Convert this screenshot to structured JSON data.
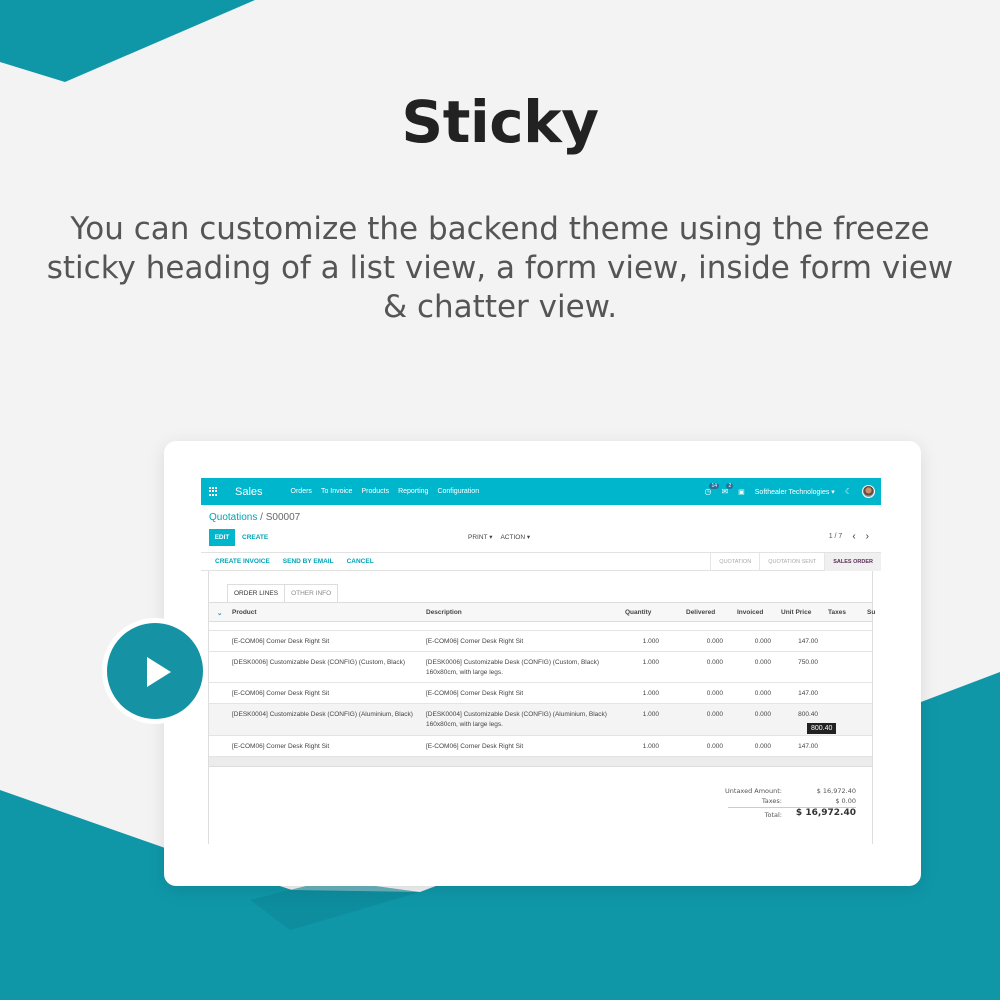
{
  "headline": "Sticky",
  "description": "You can customize the backend theme using the freeze sticky heading of a list view, a form view, inside form view & chatter view.",
  "colors": {
    "teal": "#0f97a8",
    "navbar": "#00b6cc",
    "accent_text": "#00a3b8"
  },
  "navbar": {
    "app_name": "Sales",
    "menu": [
      "Orders",
      "To Invoice",
      "Products",
      "Reporting",
      "Configuration"
    ],
    "activity_count": "14",
    "message_count": "2",
    "company": "Softhealer Technologies",
    "icons": [
      "apps-grid-icon",
      "clock-icon",
      "chat-icon",
      "gift-icon",
      "moon-icon",
      "avatar"
    ]
  },
  "breadcrumb": {
    "parent": "Quotations",
    "separator": "/",
    "current": "S00007"
  },
  "buttons": {
    "edit": "EDIT",
    "create": "CREATE",
    "print": "PRINT",
    "action": "ACTION"
  },
  "pager": {
    "text": "1 / 7"
  },
  "status_actions": [
    "CREATE INVOICE",
    "SEND BY EMAIL",
    "CANCEL"
  ],
  "stages": [
    {
      "label": "QUOTATION",
      "active": false
    },
    {
      "label": "QUOTATION SENT",
      "active": false
    },
    {
      "label": "SALES ORDER",
      "active": true
    }
  ],
  "tabs": [
    "ORDER LINES",
    "OTHER INFO"
  ],
  "table": {
    "headers": [
      "Product",
      "Description",
      "Quantity",
      "Delivered",
      "Invoiced",
      "Unit Price",
      "Taxes",
      "Su"
    ],
    "rows": [
      {
        "product": "[E-COM06] Corner Desk Right Sit",
        "description": "[E-COM06] Corner Desk Right Sit",
        "quantity": "1.000",
        "delivered": "0.000",
        "invoiced": "0.000",
        "unit_price": "147.00"
      },
      {
        "product": "[DESK0006] Customizable Desk (CONFIG) (Custom, Black)",
        "description": "[DESK0006] Customizable Desk (CONFIG) (Custom, Black)\n160x80cm, with large legs.",
        "quantity": "1.000",
        "delivered": "0.000",
        "invoiced": "0.000",
        "unit_price": "750.00"
      },
      {
        "product": "[E-COM06] Corner Desk Right Sit",
        "description": "[E-COM06] Corner Desk Right Sit",
        "quantity": "1.000",
        "delivered": "0.000",
        "invoiced": "0.000",
        "unit_price": "147.00"
      },
      {
        "product": "[DESK0004] Customizable Desk (CONFIG) (Aluminium, Black)",
        "description": "[DESK0004] Customizable Desk (CONFIG) (Aluminium, Black)\n160x80cm, with large legs.",
        "quantity": "1.000",
        "delivered": "0.000",
        "invoiced": "0.000",
        "unit_price": "800.40"
      },
      {
        "product": "[E-COM06] Corner Desk Right Sit",
        "description": "[E-COM06] Corner Desk Right Sit",
        "quantity": "1.000",
        "delivered": "0.000",
        "invoiced": "0.000",
        "unit_price": "147.00"
      }
    ],
    "tooltip": "800.40"
  },
  "totals": {
    "untaxed_label": "Untaxed Amount:",
    "untaxed_value": "$ 16,972.40",
    "taxes_label": "Taxes:",
    "taxes_value": "$ 0.00",
    "total_label": "Total:",
    "total_value": "$ 16,972.40"
  }
}
